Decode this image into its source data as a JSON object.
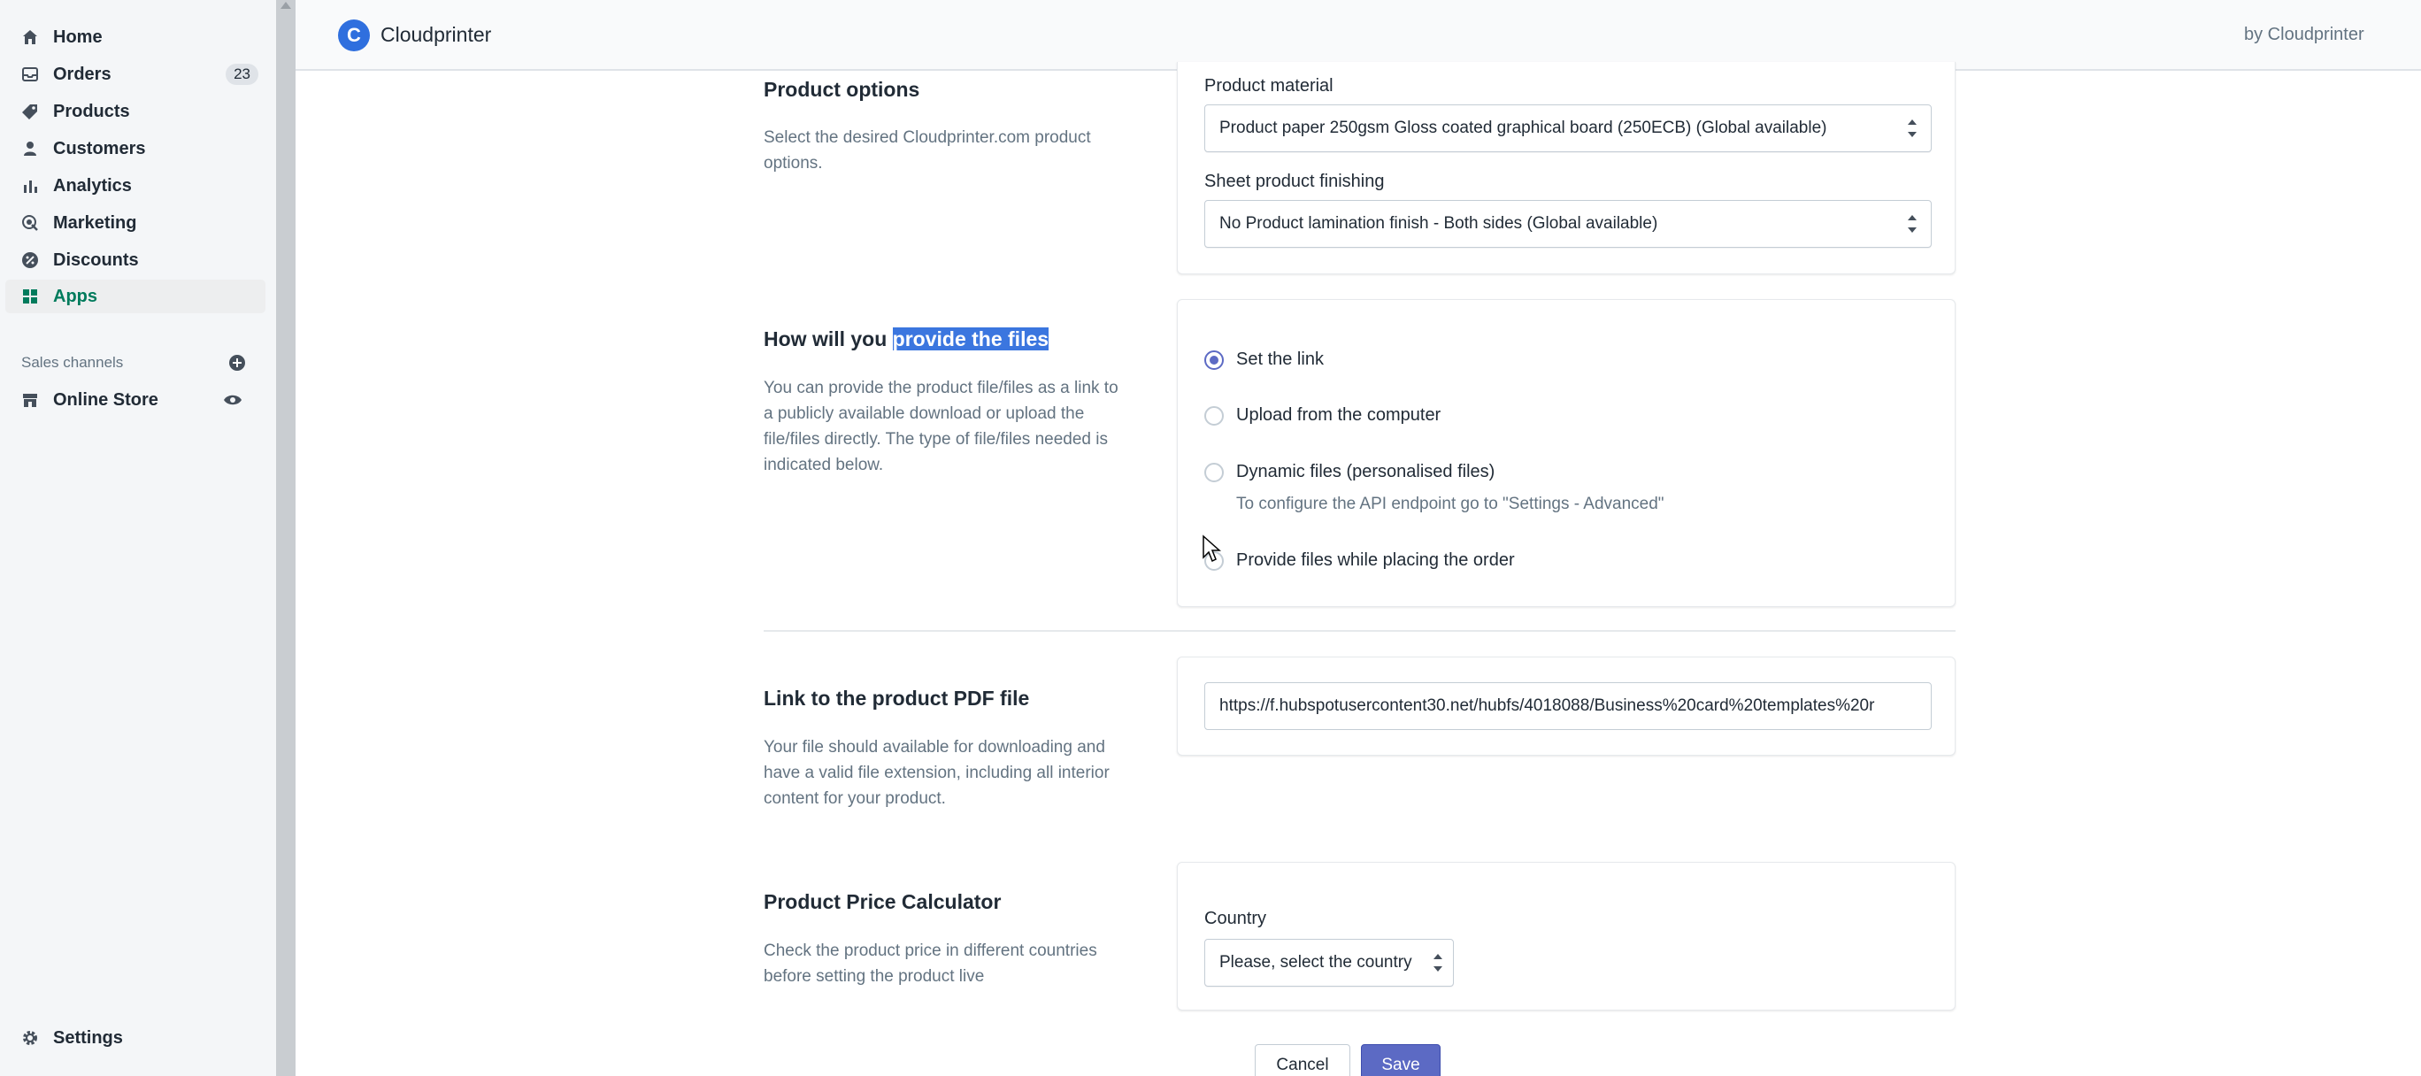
{
  "sidebar": {
    "items": [
      {
        "label": "Home",
        "icon": "home-icon"
      },
      {
        "label": "Orders",
        "icon": "orders-icon",
        "badge": "23"
      },
      {
        "label": "Products",
        "icon": "tag-icon"
      },
      {
        "label": "Customers",
        "icon": "person-icon"
      },
      {
        "label": "Analytics",
        "icon": "bar-chart-icon"
      },
      {
        "label": "Marketing",
        "icon": "marketing-icon"
      },
      {
        "label": "Discounts",
        "icon": "discount-icon"
      },
      {
        "label": "Apps",
        "icon": "apps-icon",
        "active": true
      }
    ],
    "sales_channels_heading": "Sales channels",
    "online_store_label": "Online Store",
    "settings_label": "Settings"
  },
  "topbar": {
    "app_name": "Cloudprinter",
    "by_label": "by Cloudprinter",
    "logo_letter": "C"
  },
  "product_options": {
    "title": "Product options",
    "description": "Select the desired Cloudprinter.com product options.",
    "material_label": "Product material",
    "material_value": "Product paper 250gsm Gloss coated graphical board (250ECB) (Global available)",
    "finishing_label": "Sheet product finishing",
    "finishing_value": "No Product lamination finish - Both sides (Global available)"
  },
  "provide_files": {
    "title_plain": "How will you ",
    "title_highlight": "provide the files",
    "description": "You can provide the product file/files as a link to a publicly available download or upload the file/files directly. The type of file/files needed is indicated below.",
    "options": [
      {
        "label": "Set the link",
        "checked": true
      },
      {
        "label": "Upload from the computer",
        "checked": false
      },
      {
        "label": "Dynamic files (personalised files)",
        "checked": false
      },
      {
        "label": "Provide files while placing the order",
        "checked": false
      }
    ],
    "dynamic_help": "To configure the API endpoint go to \"Settings - Advanced\""
  },
  "pdf_link": {
    "title": "Link to the product PDF file",
    "description": "Your file should available for downloading and have a valid file extension, including all interior content for your product.",
    "url_value": "https://f.hubspotusercontent30.net/hubfs/4018088/Business%20card%20templates%20r"
  },
  "price_calc": {
    "title": "Product Price Calculator",
    "description": "Check the product price in different countries before setting the product live",
    "country_label": "Country",
    "country_value": "Please, select the country"
  },
  "actions": {
    "cancel_label": "Cancel",
    "save_label": "Save"
  },
  "colors": {
    "accent": "#5c6ac4",
    "active_nav": "#007b5c",
    "highlight": "#3b76df",
    "logo": "#2f6fde"
  }
}
